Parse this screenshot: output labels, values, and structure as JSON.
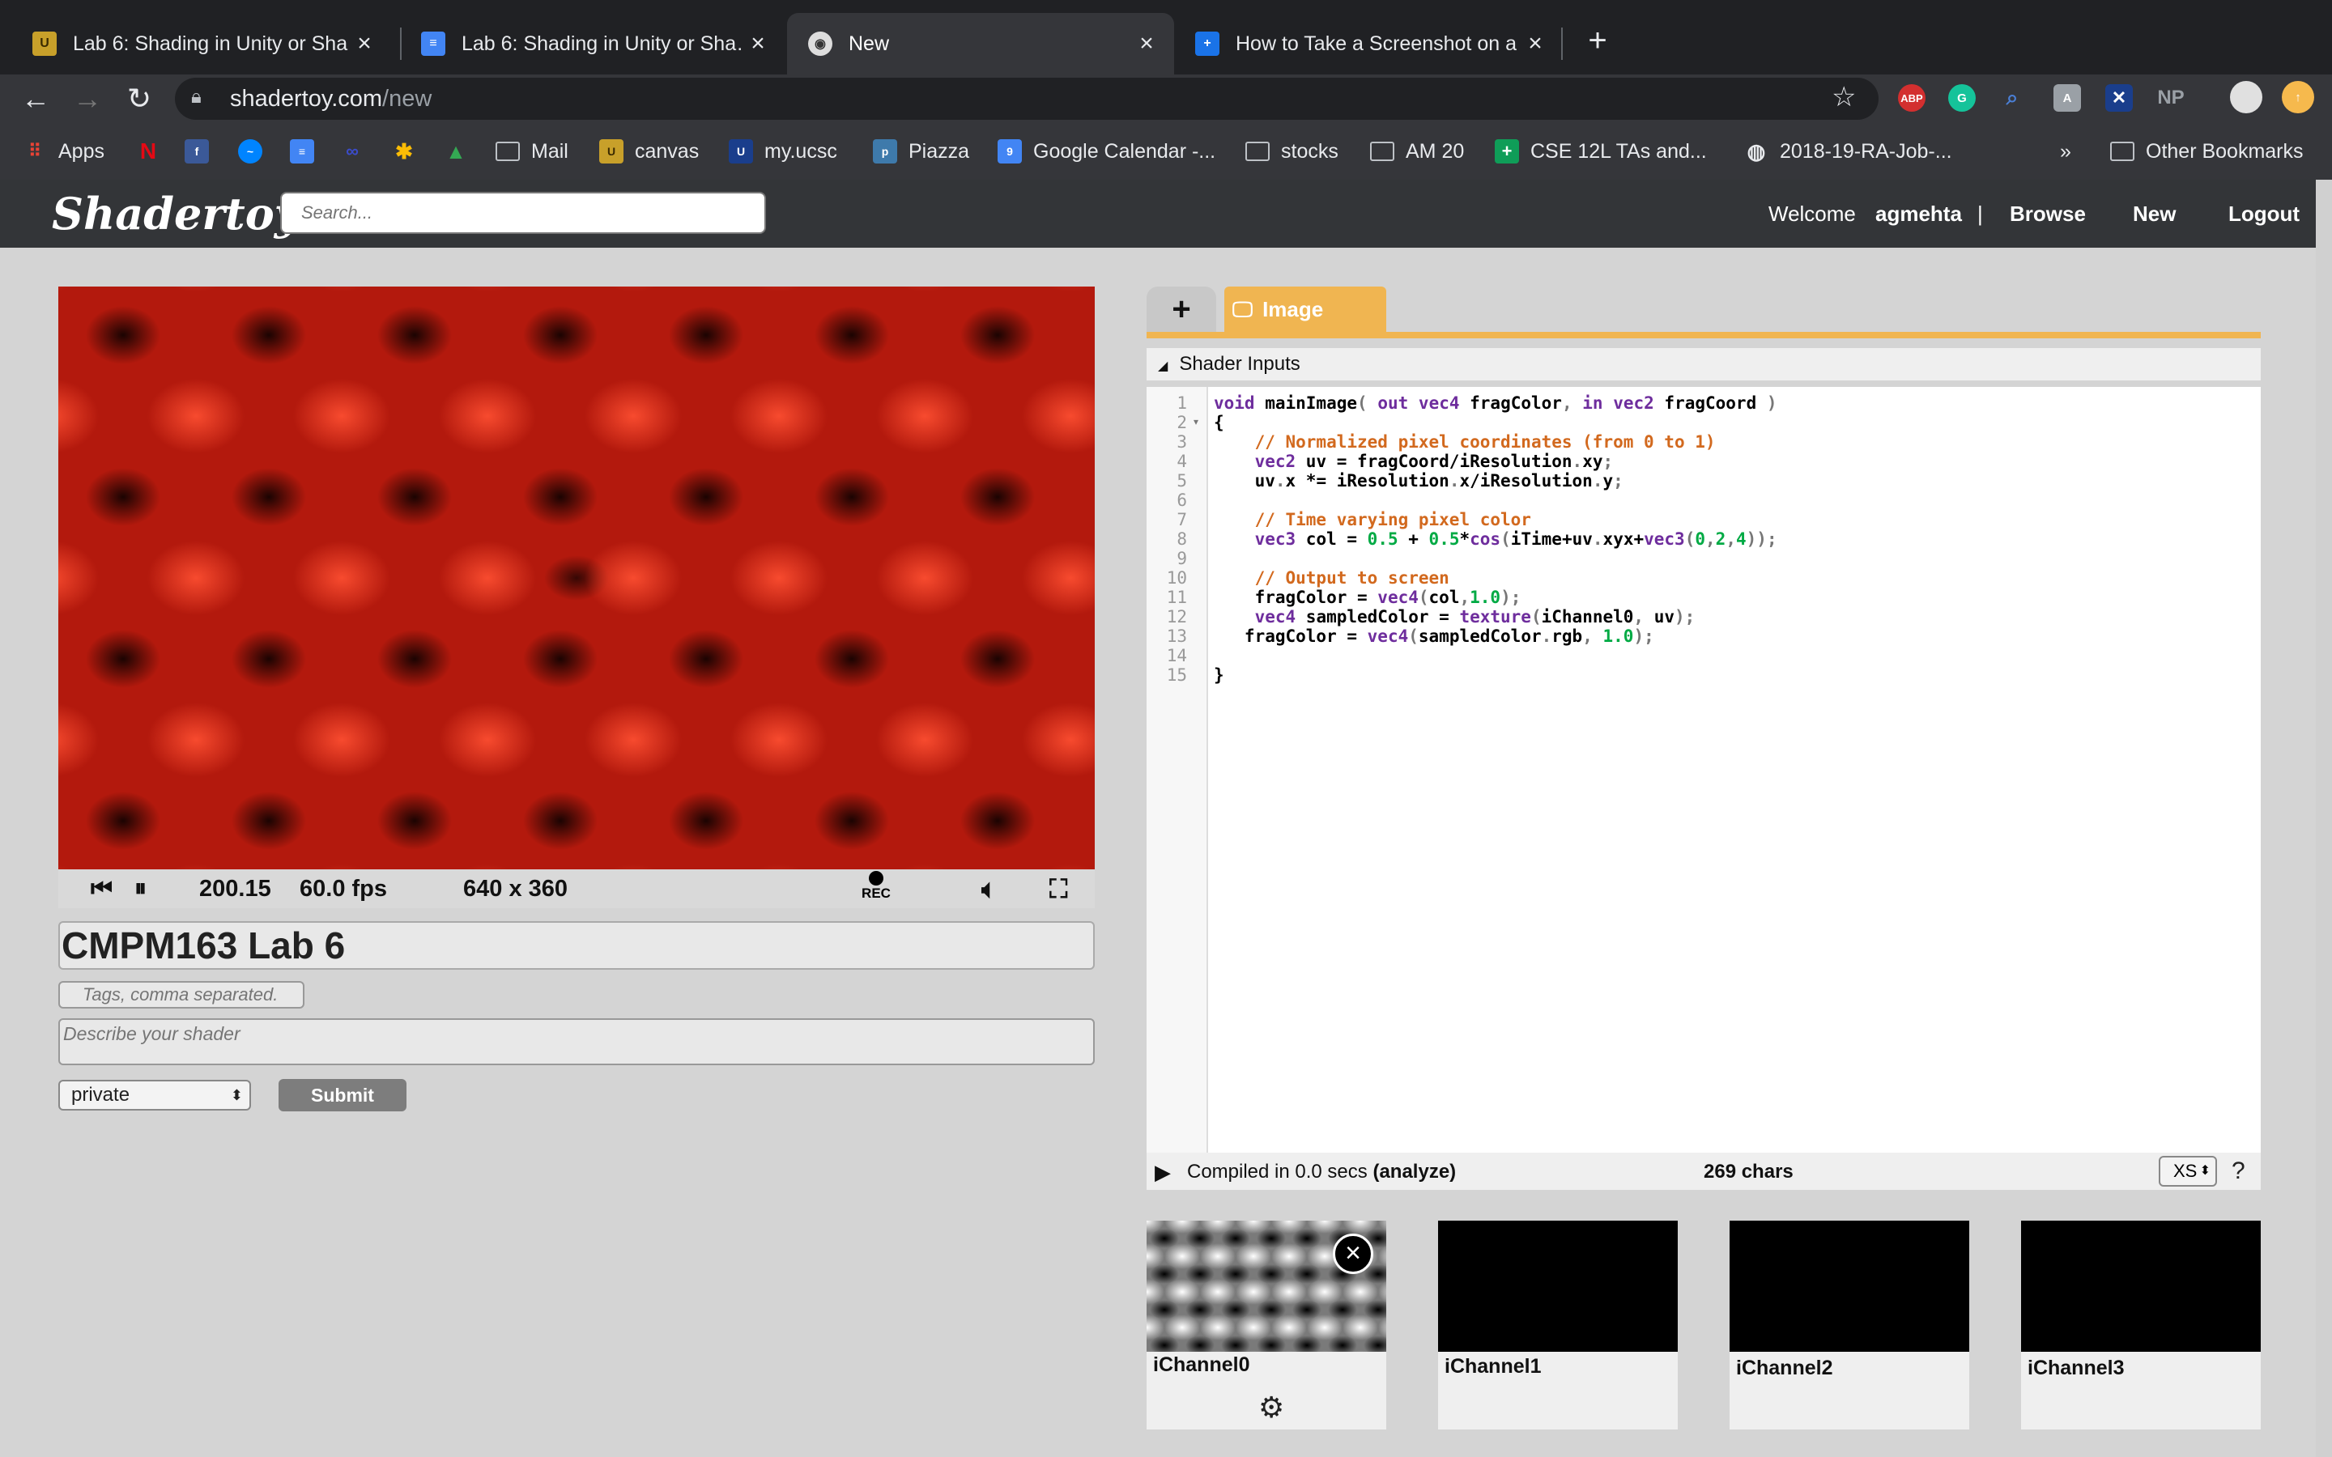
{
  "browser": {
    "tabs": [
      {
        "title": "Lab 6: Shading in Unity or Sha…",
        "favicon": "UCSC",
        "active": false
      },
      {
        "title": "Lab 6: Shading in Unity or Sha…",
        "favicon": "docs",
        "active": false
      },
      {
        "title": "New",
        "favicon": "shadertoy",
        "active": true
      },
      {
        "title": "How to Take a Screenshot on a…",
        "favicon": "plus",
        "active": false
      }
    ],
    "url_host": "shadertoy.com",
    "url_path": "/new",
    "extensions": [
      "ABP",
      "G",
      "",
      "",
      "",
      "NP"
    ],
    "bookmarks": [
      "Apps",
      "",
      "",
      "",
      "",
      "",
      "",
      "",
      "Mail",
      "canvas",
      "my.ucsc",
      "Piazza",
      "Google Calendar -...",
      "stocks",
      "AM 20",
      "CSE 12L TAs and...",
      "2018-19-RA-Job-...",
      "»",
      "Other Bookmarks"
    ]
  },
  "header": {
    "logo": "Shadertoy",
    "search_placeholder": "Search...",
    "welcome": "Welcome",
    "username": "agmehta",
    "separator": "|",
    "browse": "Browse",
    "new": "New",
    "logout": "Logout"
  },
  "player": {
    "time": "200.15",
    "fps": "60.0 fps",
    "resolution": "640 x 360",
    "rec": "REC"
  },
  "form": {
    "title": "CMPM163 Lab 6",
    "tags_placeholder": "Tags, comma separated.",
    "desc_placeholder": "Describe your shader",
    "visibility": "private",
    "submit": "Submit"
  },
  "editor": {
    "add_tab": "+",
    "image_tab": "Image",
    "shader_inputs": "Shader Inputs",
    "line_numbers": [
      "1",
      "2",
      "3",
      "4",
      "5",
      "6",
      "7",
      "8",
      "9",
      "10",
      "11",
      "12",
      "13",
      "14",
      "15"
    ],
    "lines": [
      "void mainImage( out vec4 fragColor, in vec2 fragCoord )",
      "{",
      "    // Normalized pixel coordinates (from 0 to 1)",
      "    vec2 uv = fragCoord/iResolution.xy;",
      "    uv.x *= iResolution.x/iResolution.y;",
      "",
      "    // Time varying pixel color",
      "    vec3 col = 0.5 + 0.5*cos(iTime+uv.xyx+vec3(0,2,4));",
      "",
      "    // Output to screen",
      "    fragColor = vec4(col,1.0);",
      "    vec4 sampledColor = texture(iChannel0, uv);",
      "   fragColor = vec4(sampledColor.rgb, 1.0);",
      "",
      "}"
    ],
    "compiled": "Compiled in 0.0 secs",
    "analyze": "(analyze)",
    "chars": "269 chars",
    "font_size": "XS",
    "help": "?"
  },
  "channels": [
    "iChannel0",
    "iChannel1",
    "iChannel2",
    "iChannel3"
  ],
  "colors": {
    "accent": "#f0b551",
    "keyword": "#6e2d9d",
    "comment": "#d2691e",
    "number": "#00aa44"
  }
}
